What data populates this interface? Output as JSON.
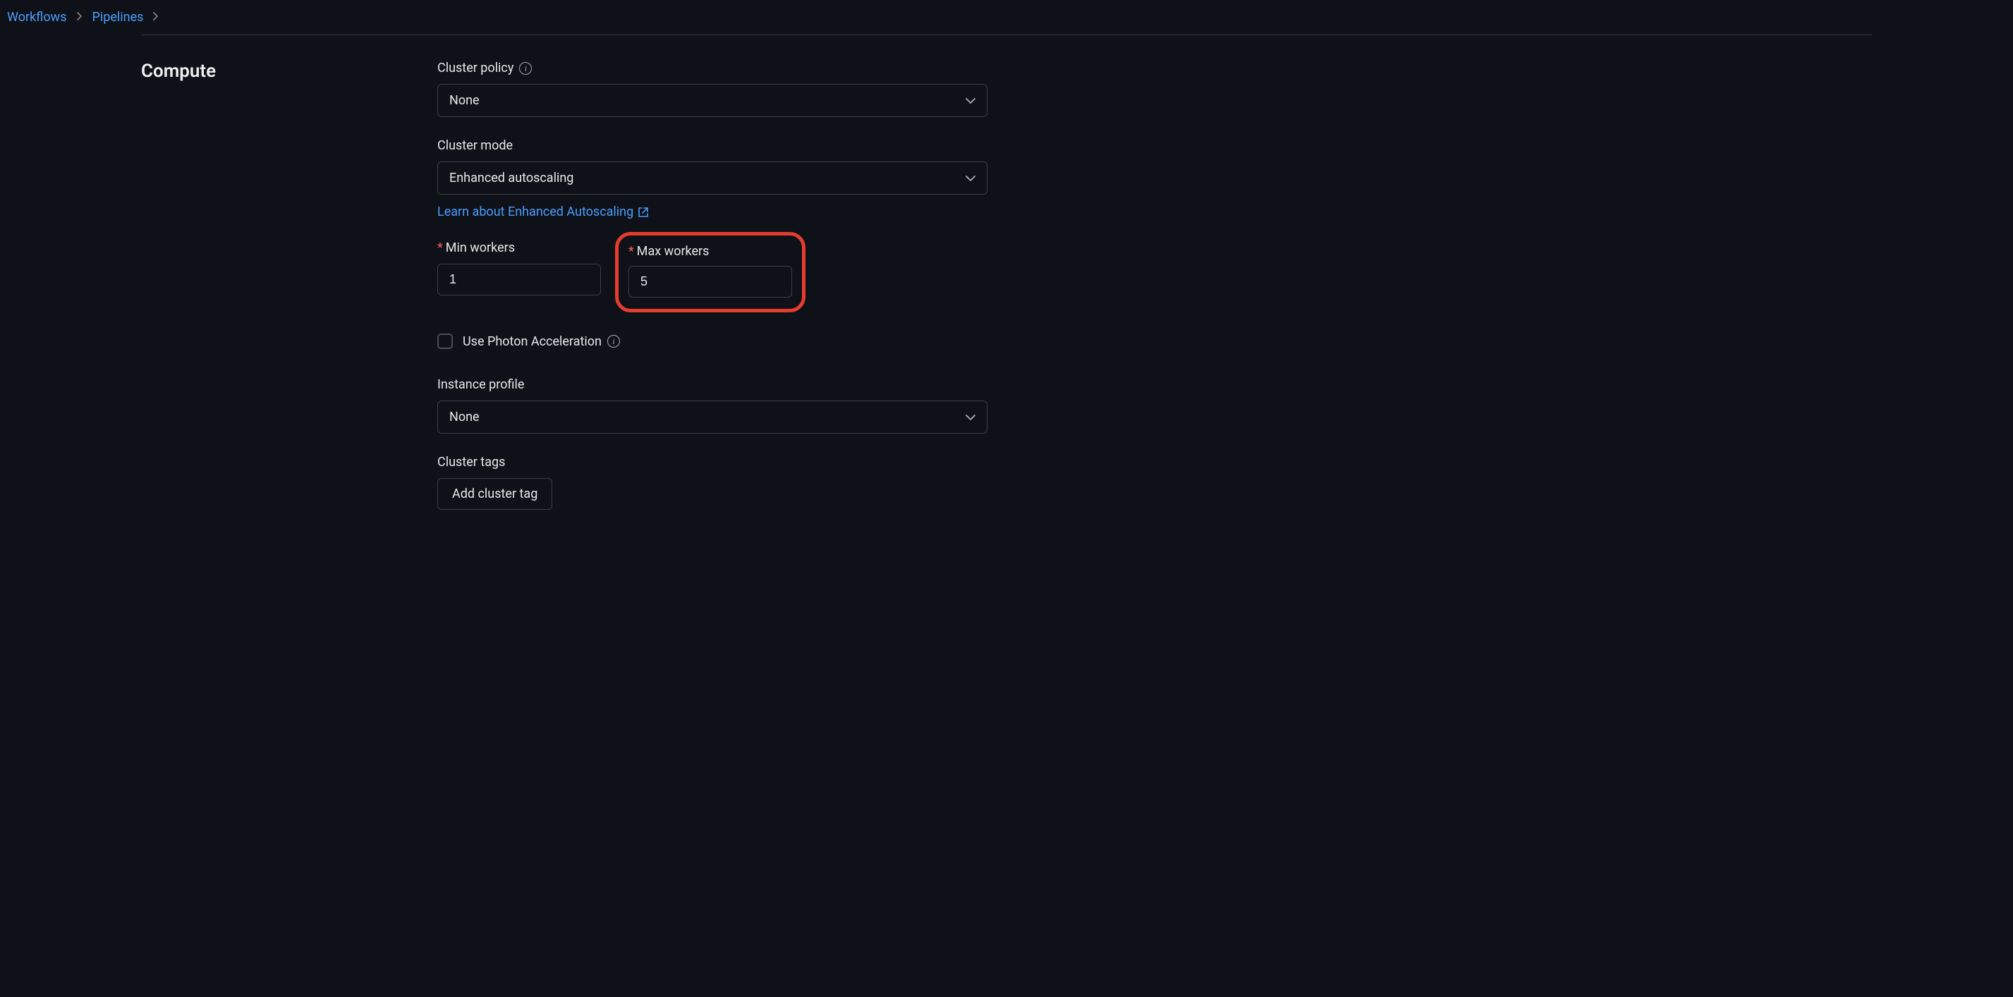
{
  "breadcrumb": {
    "items": [
      "Workflows",
      "Pipelines"
    ]
  },
  "section": {
    "title": "Compute"
  },
  "form": {
    "cluster_policy": {
      "label": "Cluster policy",
      "value": "None"
    },
    "cluster_mode": {
      "label": "Cluster mode",
      "value": "Enhanced autoscaling",
      "help_link": "Learn about Enhanced Autoscaling"
    },
    "min_workers": {
      "label": "Min workers",
      "value": "1"
    },
    "max_workers": {
      "label": "Max workers",
      "value": "5"
    },
    "photon": {
      "label": "Use Photon Acceleration"
    },
    "instance_profile": {
      "label": "Instance profile",
      "value": "None"
    },
    "cluster_tags": {
      "label": "Cluster tags",
      "button": "Add cluster tag"
    }
  }
}
